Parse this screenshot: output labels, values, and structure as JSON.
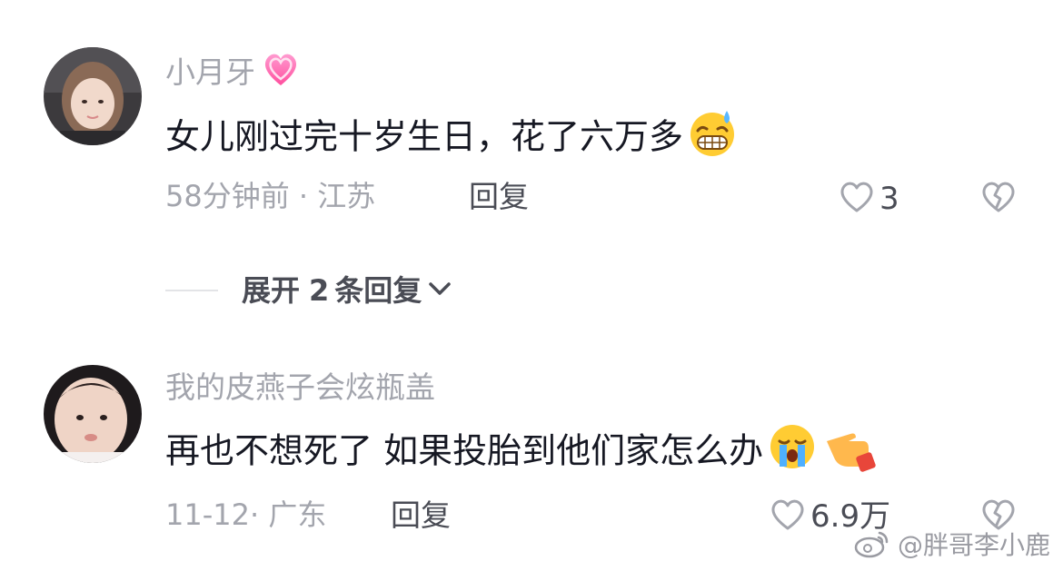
{
  "comments": [
    {
      "username": "小月牙",
      "username_emoji": "pink-heart-icon",
      "text": "女儿刚过完十岁生日，花了六万多",
      "text_emojis": [
        "grinning-sweat-icon"
      ],
      "time": "58分钟前",
      "location": "江苏",
      "meta_separator": "·",
      "reply_label": "回复",
      "likes": "3"
    },
    {
      "username": "我的皮燕子会炫瓶盖",
      "text": "再也不想死了 如果投胎到他们家怎么办",
      "text_emojis": [
        "loudly-crying-icon",
        "pointing-hand-icon"
      ],
      "time": "11-12",
      "location": "广东",
      "meta_separator": "·",
      "reply_label": "回复",
      "likes": "6.9万"
    }
  ],
  "expand_replies": {
    "label": "展开",
    "count": "2",
    "unit": "条回复"
  },
  "watermark": {
    "text": "@胖哥李小鹿",
    "icon": "weibo-logo-icon"
  },
  "colors": {
    "username": "#a3a5ad",
    "text": "#161823",
    "meta": "#a3a5ad",
    "action": "#4a4c55",
    "divider": "#e3e4e7"
  }
}
